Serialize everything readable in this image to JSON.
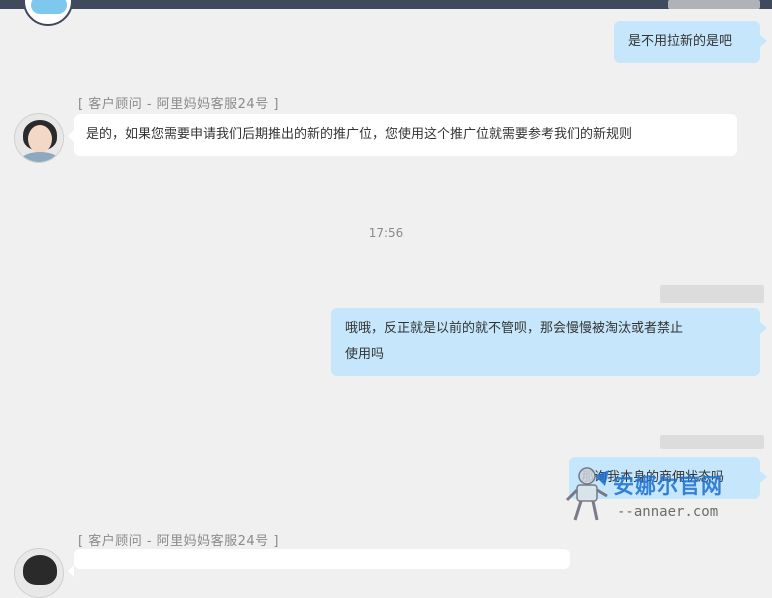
{
  "messages": {
    "m1": "是不用拉新的是吧",
    "m2_sender": "[ 客户顾问 - 阿里妈妈客服24号 ]",
    "m2": "是的，如果您需要申请我们后期推出的新的推广位，您使用这个推广位就需要参考我们的新规则",
    "time": "17:56",
    "m3_line1": "哦哦，反正就是以前的就不管呗，那会慢慢被淘汰或者禁止",
    "m3_line2": "使用吗",
    "m4": "那询我本身的商佣状态吗",
    "m5_sender": "[ 客户顾问 - 阿里妈妈客服24号 ]"
  },
  "watermark": {
    "title": "安娜尔官网",
    "subtitle": "--annaer.com"
  }
}
